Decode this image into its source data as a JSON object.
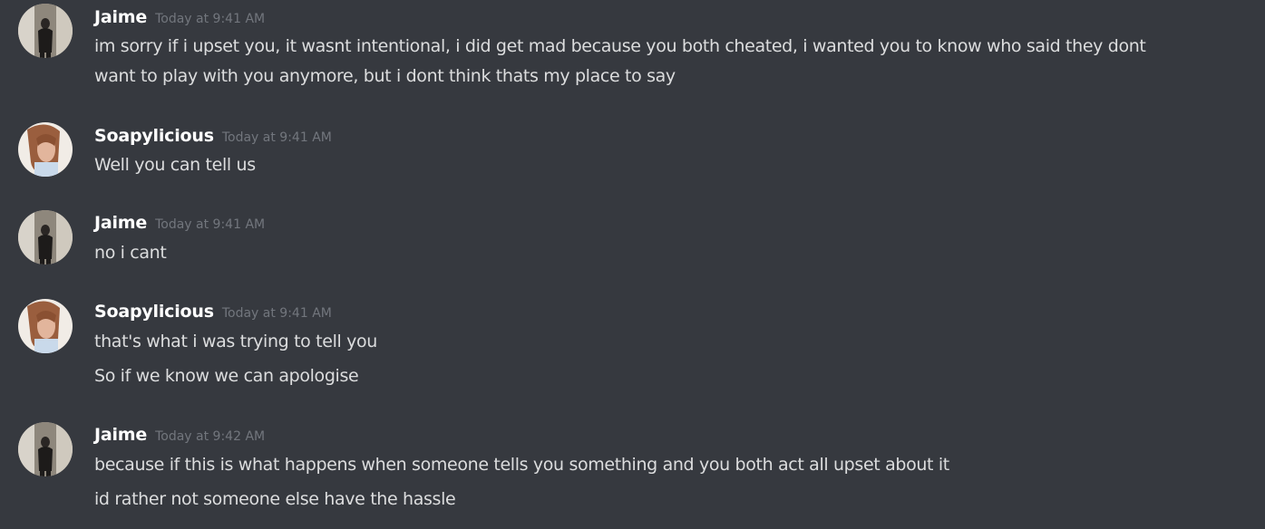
{
  "messages": [
    {
      "author": "Jaime",
      "timestamp": "Today at 9:41 AM",
      "avatar_icon": "jaime-avatar-icon",
      "lines": [
        "im sorry if i upset you, it wasnt intentional, i did get mad because you both cheated, i wanted you to know who said they dont",
        "want to play with you anymore, but i dont think thats my place to say"
      ]
    },
    {
      "author": "Soapylicious",
      "timestamp": "Today at 9:41 AM",
      "avatar_icon": "soapylicious-avatar-icon",
      "lines": [
        "Well you can tell us"
      ]
    },
    {
      "author": "Jaime",
      "timestamp": "Today at 9:41 AM",
      "avatar_icon": "jaime-avatar-icon",
      "lines": [
        "no i cant"
      ]
    },
    {
      "author": "Soapylicious",
      "timestamp": "Today at 9:41 AM",
      "avatar_icon": "soapylicious-avatar-icon",
      "lines": [
        "that's what i was trying to tell you",
        "So if we know we can apologise"
      ]
    },
    {
      "author": "Jaime",
      "timestamp": "Today at 9:42 AM",
      "avatar_icon": "jaime-avatar-icon",
      "lines": [
        "because if this is what happens when someone tells you something and you both act all upset about it",
        "id rather not someone else have the hassle"
      ]
    }
  ],
  "colors": {
    "background": "#36393f",
    "username": "#ffffff",
    "timestamp": "#72767d",
    "text": "#dcddde"
  }
}
